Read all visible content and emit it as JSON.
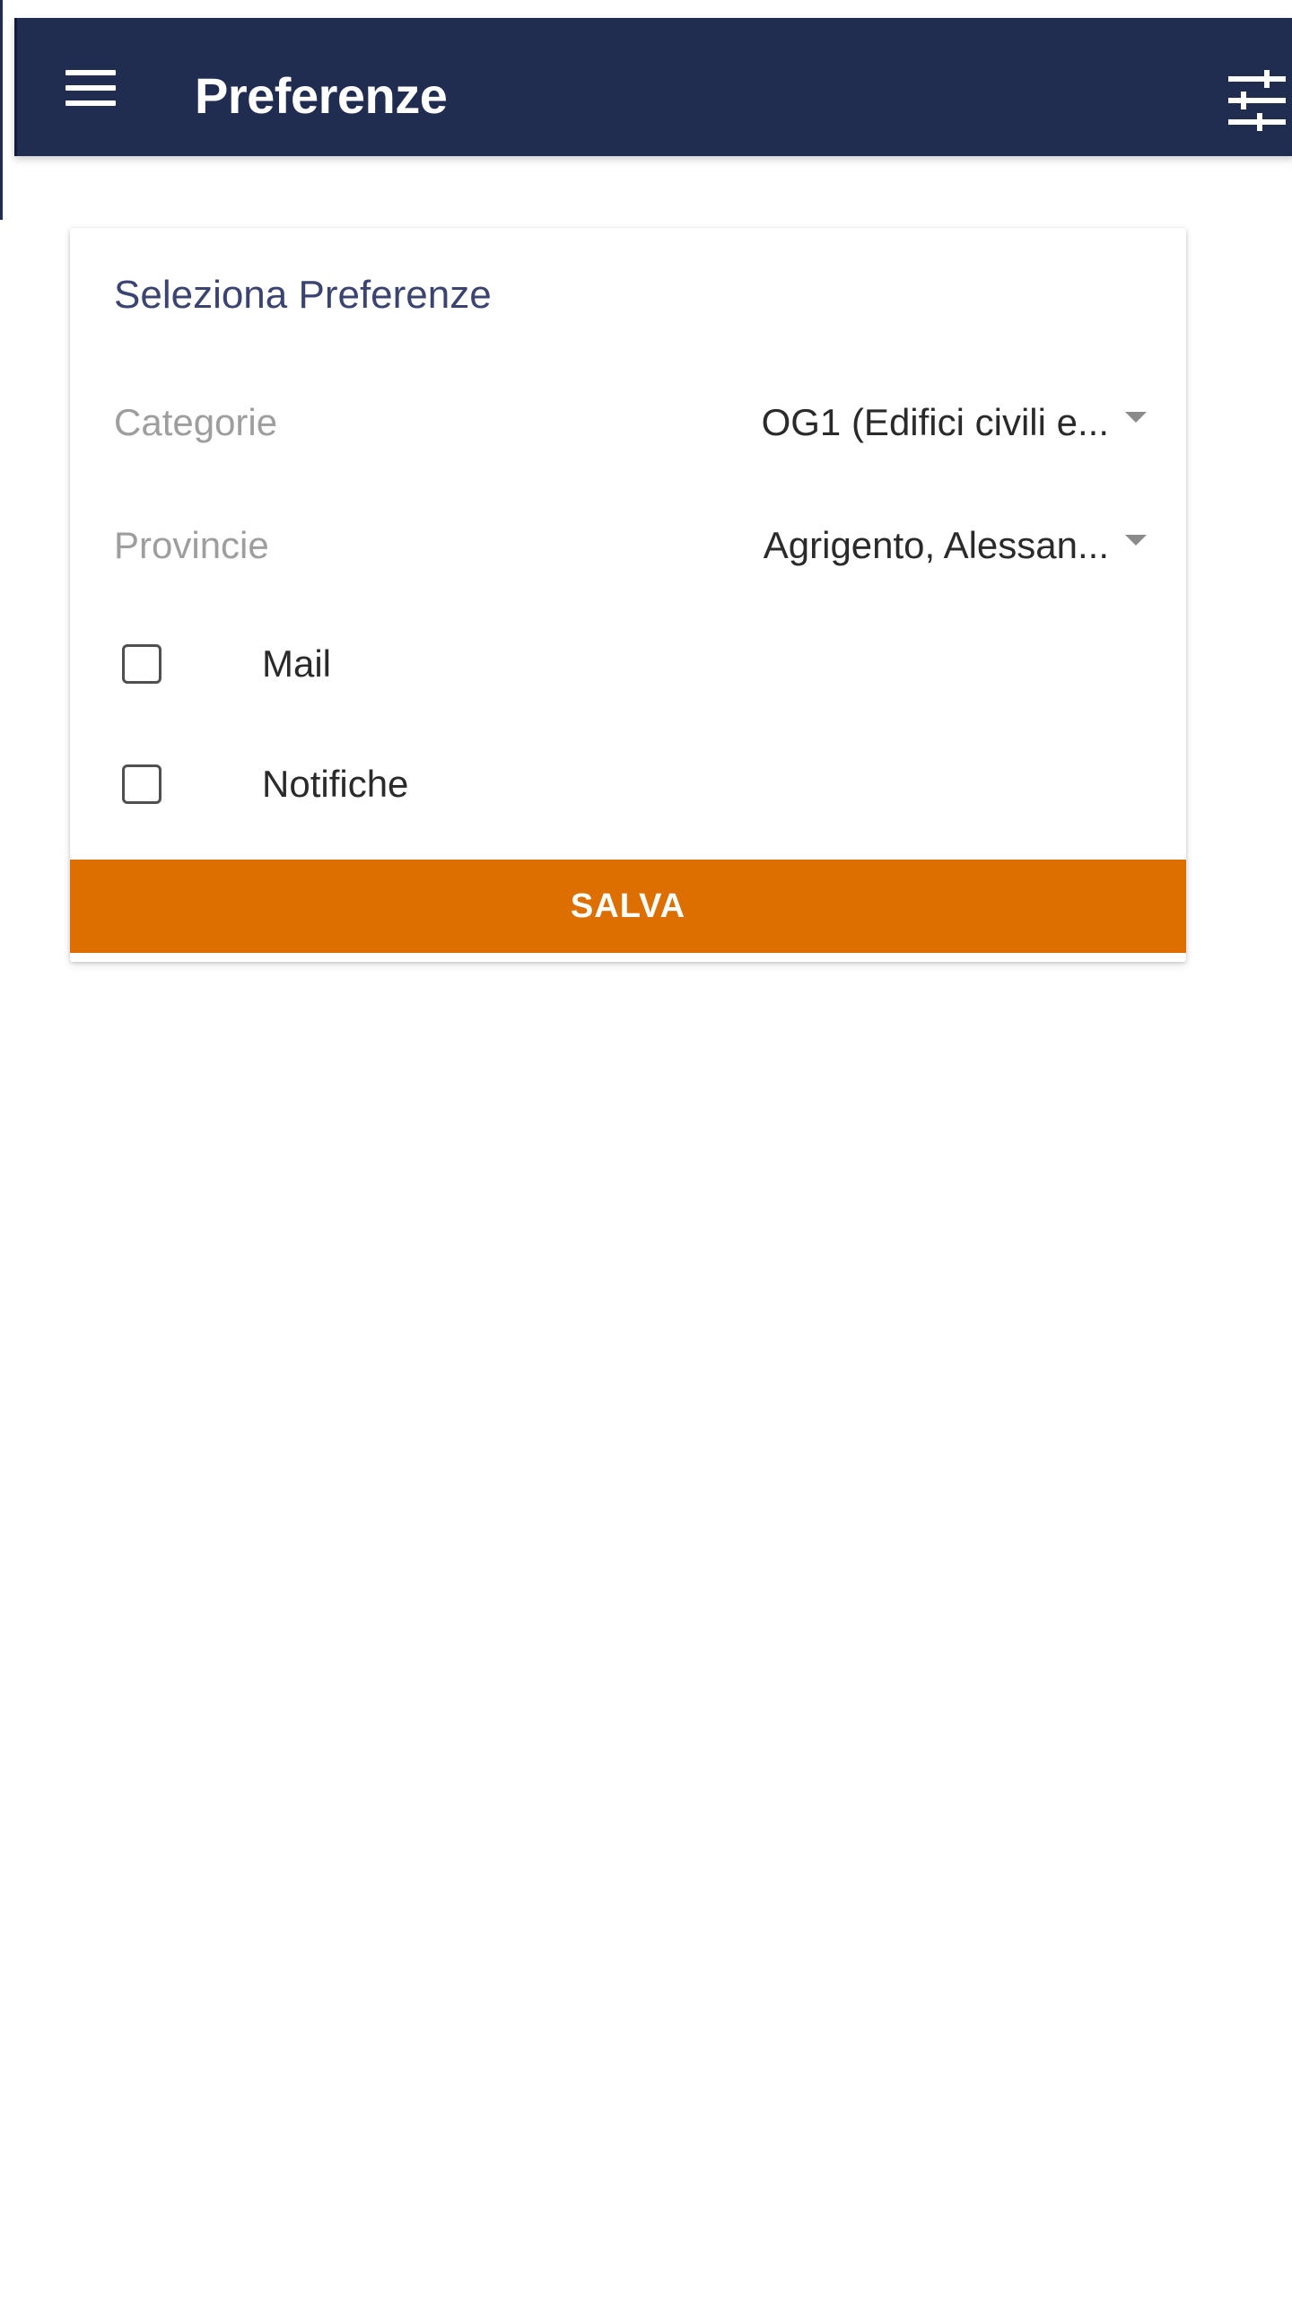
{
  "colors": {
    "app_bar": "#212c51",
    "accent_button": "#dc6f00",
    "card_title": "#3b4471",
    "label_gray": "#9e9e9e"
  },
  "header": {
    "title": "Preferenze",
    "menu_icon": "hamburger-menu-icon",
    "action_icon": "tune-sliders-icon"
  },
  "card": {
    "title": "Seleziona Preferenze",
    "fields": [
      {
        "label": "Categorie",
        "value": "OG1 (Edifici civili e..."
      },
      {
        "label": "Provincie",
        "value": "Agrigento, Alessan..."
      }
    ],
    "checkboxes": [
      {
        "label": "Mail",
        "checked": false
      },
      {
        "label": "Notifiche",
        "checked": false
      }
    ],
    "save_label": "SALVA"
  }
}
